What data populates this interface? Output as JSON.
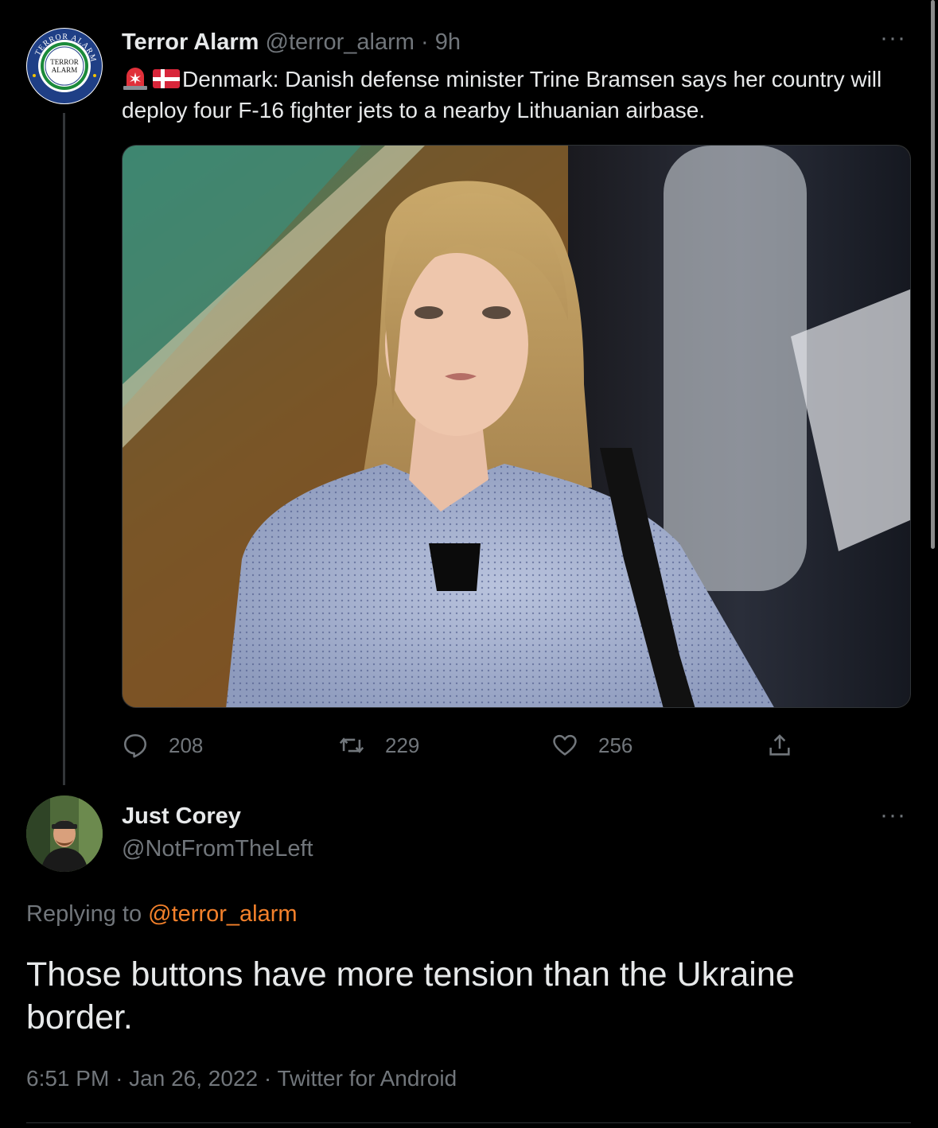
{
  "parent_tweet": {
    "author_name": "Terror Alarm",
    "author_handle": "@terror_alarm",
    "separator": "·",
    "time_ago": "9h",
    "avatar_text": "TERROR ALARM",
    "avatar_ring_text": "TERROR ALARM",
    "emoji": [
      "police-siren",
      "flag-denmark"
    ],
    "text": "Denmark: Danish defense minister Trine Bramsen says her country will deploy four F-16 fighter jets to a nearby Lithuanian airbase.",
    "more_label": "···",
    "actions": {
      "replies": "208",
      "retweets": "229",
      "likes": "256"
    }
  },
  "reply_tweet": {
    "author_name": "Just Corey",
    "author_handle": "@NotFromTheLeft",
    "more_label": "···",
    "replying_prefix": "Replying to",
    "replying_to": "@terror_alarm",
    "text": "Those buttons have more tension than the Ukraine border.",
    "time": "6:51 PM",
    "date": "Jan 26, 2022",
    "source": "Twitter for Android",
    "meta_separator": "·"
  },
  "colors": {
    "background": "#000000",
    "text_primary": "#e7e9ea",
    "text_secondary": "#71767b",
    "mention": "#f4812b",
    "border": "#2f3336"
  },
  "icons": {
    "reply": "speech-bubble-icon",
    "retweet": "retweet-icon",
    "like": "heart-icon",
    "share": "share-icon",
    "more": "ellipsis-icon"
  }
}
